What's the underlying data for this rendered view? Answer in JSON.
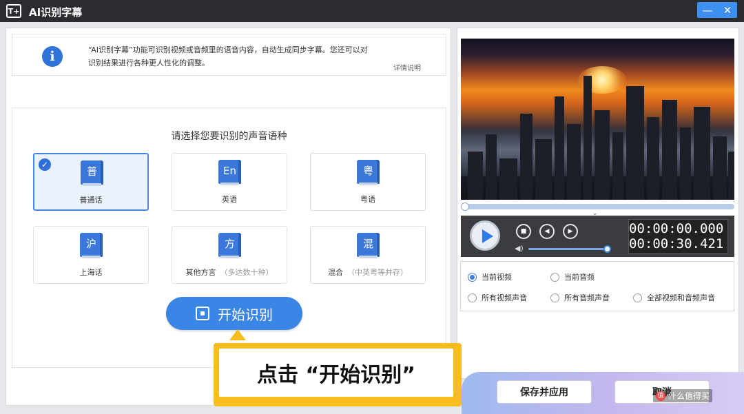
{
  "window": {
    "logo_text": "T+",
    "title": "AI识别字幕",
    "minimize_glyph": "—",
    "close_glyph": "✕"
  },
  "info": {
    "line1": "“AI识别字幕”功能可识别视频或音频里的语音内容，自动生成同步字幕。您还可以对",
    "line2": "识别结果进行各种更人性化的调整。",
    "details_link": "详情说明"
  },
  "language": {
    "prompt": "请选择您要识别的声音语种",
    "selected_mark": "✓",
    "options": [
      {
        "glyph": "普",
        "label": "普通话",
        "sub": ""
      },
      {
        "glyph": "En",
        "label": "英语",
        "sub": ""
      },
      {
        "glyph": "粤",
        "label": "粤语",
        "sub": ""
      },
      {
        "glyph": "沪",
        "label": "上海话",
        "sub": ""
      },
      {
        "glyph": "方",
        "label": "其他方言",
        "sub": "（多达数十种）"
      },
      {
        "glyph": "混",
        "label": "混合",
        "sub": "（中英粤等并存）"
      }
    ],
    "selected_index": 0
  },
  "start_button": "开始识别",
  "callout": "点击 “开始识别”",
  "player": {
    "progress": 0.0,
    "volume": 1.0,
    "time_current": "00:00:00.000",
    "time_total": "00:00:30.421",
    "stop_glyph": "■",
    "prev_glyph": "◀",
    "next_glyph": "▶",
    "volume_glyph": "◀)"
  },
  "source": {
    "options": [
      "当前视频",
      "当前音频",
      "所有视频声音",
      "所有音频声音",
      "全部视频和音频声音"
    ],
    "selected_index": 0
  },
  "footer": {
    "save_apply": "保存并应用",
    "cancel": "取消"
  },
  "watermark": {
    "mark": "值",
    "text": "什么值得买"
  },
  "colors": {
    "accent": "#3a86e6",
    "titlebar": "#2b2c30",
    "callout": "#f7bd1f"
  }
}
